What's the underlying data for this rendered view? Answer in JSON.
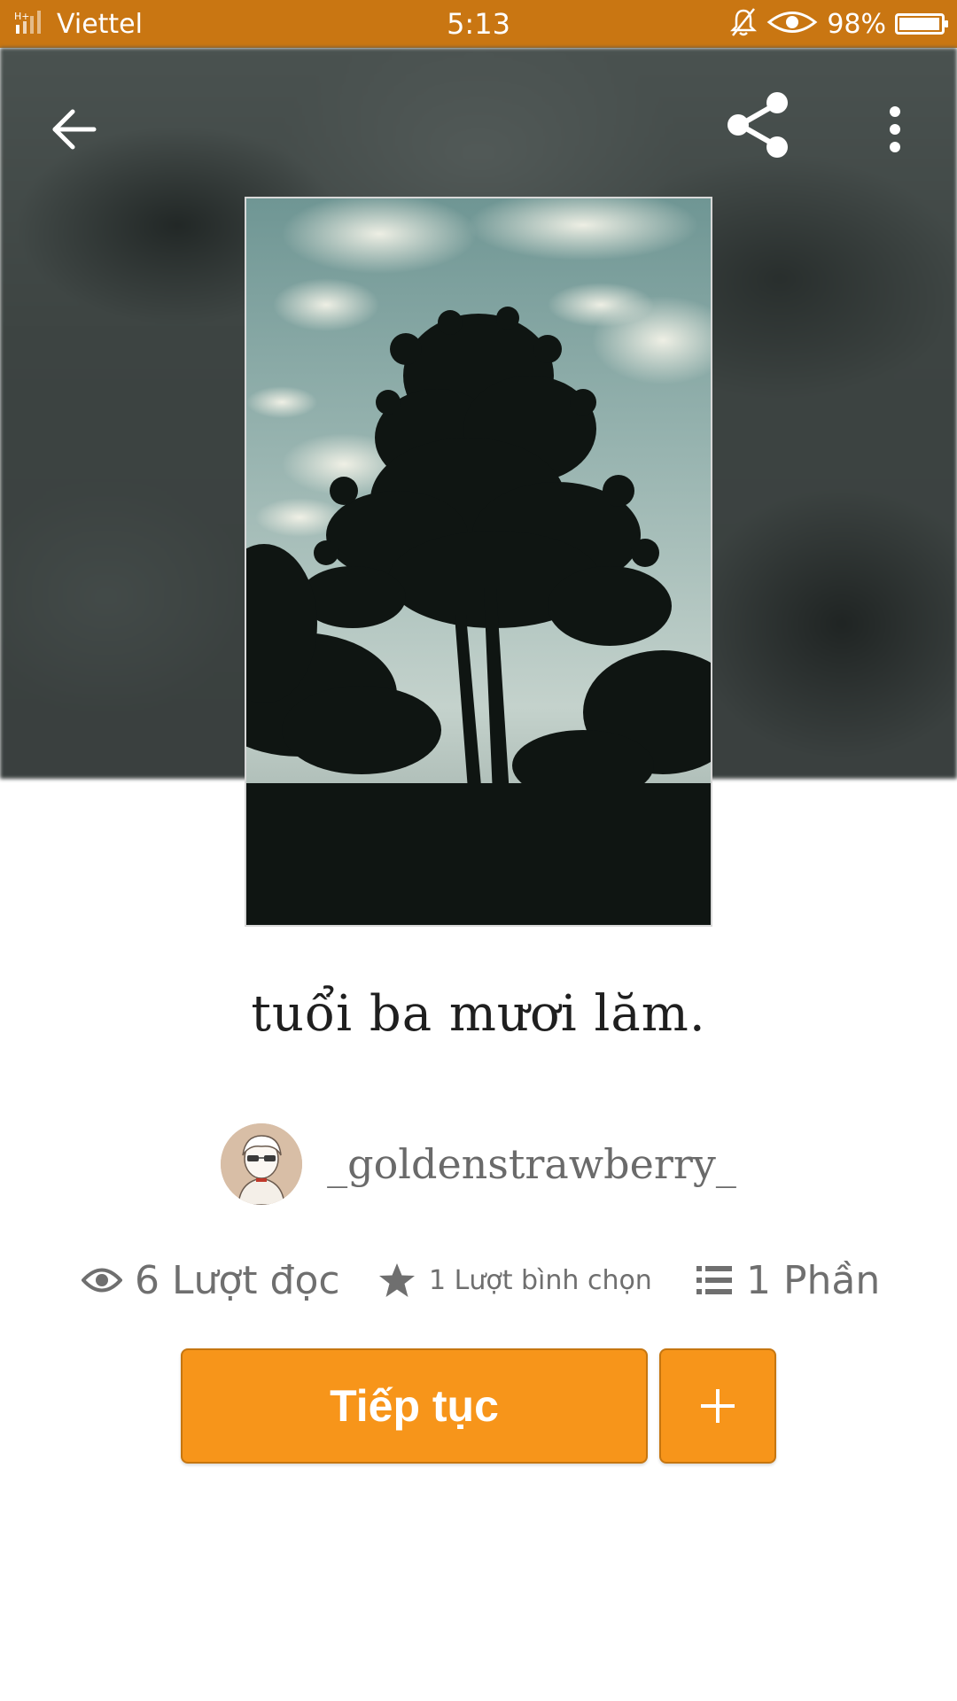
{
  "status_bar": {
    "carrier": "Viettel",
    "time": "5:13",
    "battery_percent": "98%",
    "battery_level": 0.98
  },
  "toolbar": {
    "back_icon": "arrow-left-icon",
    "share_icon": "share-icon",
    "more_icon": "more-vert-icon"
  },
  "story": {
    "title": "tuổi ba mươi lăm.",
    "author": "_goldenstrawberry_"
  },
  "stats": {
    "reads": "6 Lượt đọc",
    "votes": "1 Lượt bình chọn",
    "parts": "1 Phần"
  },
  "actions": {
    "continue_label": "Tiếp tục",
    "add_icon": "plus-icon"
  },
  "colors": {
    "status_bar": "#c97612",
    "accent": "#f7951a",
    "accent_border": "#c67610"
  }
}
